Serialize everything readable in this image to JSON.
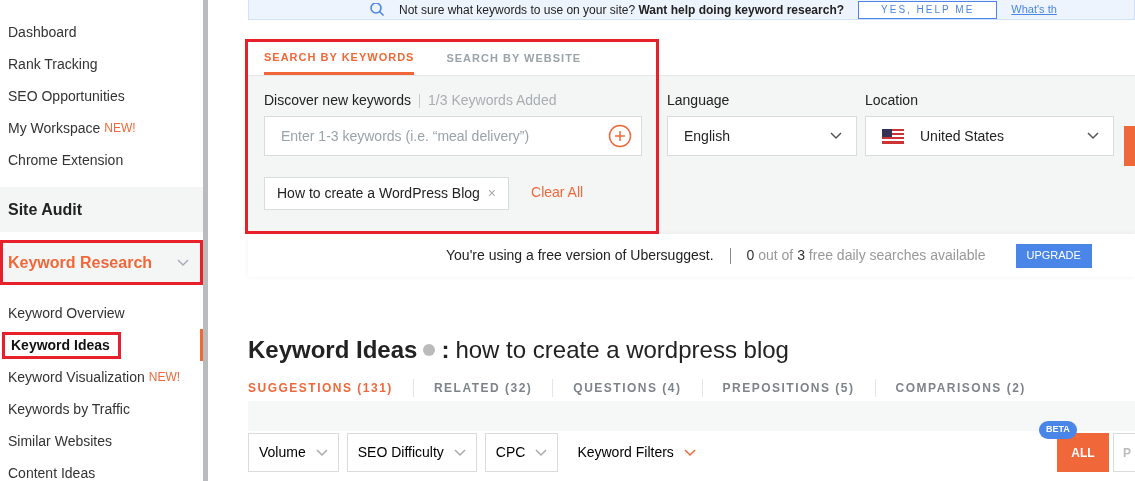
{
  "sidebar": {
    "items": [
      {
        "label": "Dashboard",
        "selected": false
      },
      {
        "label": "Rank Tracking",
        "selected": false
      },
      {
        "label": "SEO Opportunities",
        "selected": false
      },
      {
        "label": "My Workspace",
        "badge": "NEW!",
        "selected": false
      },
      {
        "label": "Chrome Extension",
        "selected": false
      }
    ],
    "sections": [
      {
        "label": "Site Audit",
        "highlighted": false,
        "chevron": false,
        "selected": false
      },
      {
        "label": "Keyword Research",
        "highlighted": true,
        "chevron": true,
        "selected": true
      }
    ],
    "subitems": [
      {
        "label": "Keyword Overview",
        "selected": false,
        "highlighted": false
      },
      {
        "label": "Keyword Ideas",
        "selected": true,
        "highlighted": true
      },
      {
        "label": "Keyword Visualization",
        "badge": "NEW!",
        "selected": false,
        "highlighted": false
      },
      {
        "label": "Keywords by Traffic",
        "selected": false,
        "highlighted": false
      },
      {
        "label": "Similar Websites",
        "selected": false,
        "highlighted": false
      },
      {
        "label": "Content Ideas",
        "selected": false,
        "highlighted": false
      }
    ]
  },
  "banner": {
    "text": "Not sure what keywords to use on your site? **Want help doing keyword research?**",
    "button": "YES, HELP ME",
    "link": "What's th"
  },
  "search": {
    "highlighted": true,
    "tabs": [
      {
        "label": "SEARCH BY KEYWORDS",
        "selected": true
      },
      {
        "label": "SEARCH BY WEBSITE",
        "selected": false
      }
    ],
    "keywords_label": "Discover new keywords",
    "keywords_count": "1/3 Keywords Added",
    "placeholder": "Enter 1-3 keywords (i.e. “meal delivery”)",
    "language_label": "Language",
    "language": "English",
    "location_label": "Location",
    "location": "United States",
    "chips": [
      {
        "label": "How to create a WordPress Blog",
        "remove": "×"
      }
    ],
    "clear": "Clear All"
  },
  "notice": {
    "text": "You're using a free version of Ubersuggest.",
    "usage": "**0** out of **3** free daily searches available",
    "button": "UPGRADE"
  },
  "heading": {
    "title": "Keyword Ideas",
    "separator": ":",
    "query": "how to create a wordpress blog"
  },
  "tabs": [
    {
      "label": "SUGGESTIONS (131)",
      "selected": true
    },
    {
      "label": "RELATED (32)",
      "selected": false
    },
    {
      "label": "QUESTIONS (4)",
      "selected": false
    },
    {
      "label": "PREPOSITIONS (5)",
      "selected": false
    },
    {
      "label": "COMPARISONS (2)",
      "selected": false
    }
  ],
  "filters": [
    {
      "label": "Volume",
      "kind": "dropdown"
    },
    {
      "label": "SEO Difficulty",
      "kind": "dropdown"
    },
    {
      "label": "CPC",
      "kind": "dropdown"
    },
    {
      "label": "Keyword Filters",
      "kind": "plain"
    }
  ],
  "view": {
    "badge": "BETA",
    "buttons": [
      {
        "label": "ALL",
        "selected": true
      },
      {
        "label": "P",
        "selected": false
      }
    ]
  }
}
